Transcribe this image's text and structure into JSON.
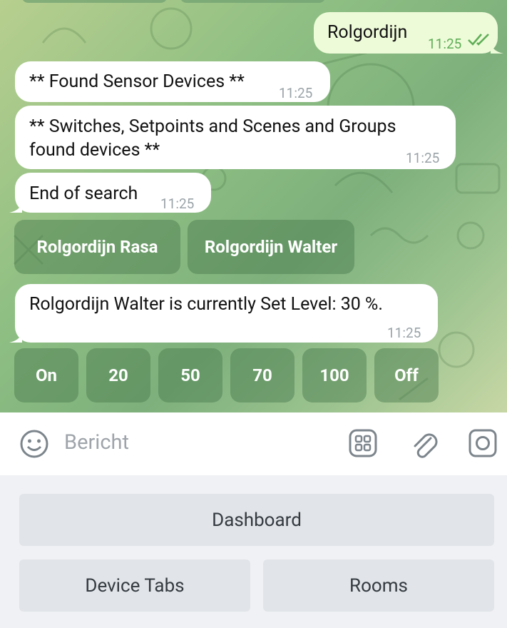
{
  "messages": [
    {
      "id": "out1",
      "text": "Rolgordijn",
      "time": "11:25",
      "status": "read"
    },
    {
      "id": "in1",
      "text": "** Found Sensor Devices **",
      "time": "11:25"
    },
    {
      "id": "in2",
      "line1": "** Switches, Setpoints and Scenes and Groups",
      "line2": "found devices **",
      "time": "11:25"
    },
    {
      "id": "in3",
      "text": "End of search",
      "time": "11:25"
    },
    {
      "id": "in4",
      "text": "Rolgordijn Walter is currently Set Level: 30 %.",
      "time": "11:25"
    }
  ],
  "inline_keyboard_1": [
    "Rolgordijn Rasa",
    "Rolgordijn Walter"
  ],
  "inline_keyboard_2": [
    "On",
    "20",
    "50",
    "70",
    "100",
    "Off"
  ],
  "input": {
    "placeholder": "Bericht"
  },
  "reply_keyboard": {
    "row1": [
      "Dashboard"
    ],
    "row2": [
      "Device Tabs",
      "Rooms"
    ]
  },
  "colors": {
    "chat_bg": "#8fbf83",
    "out_bubble": "#eefbd9",
    "in_bubble": "#ffffff",
    "read_check": "#5fae57"
  }
}
